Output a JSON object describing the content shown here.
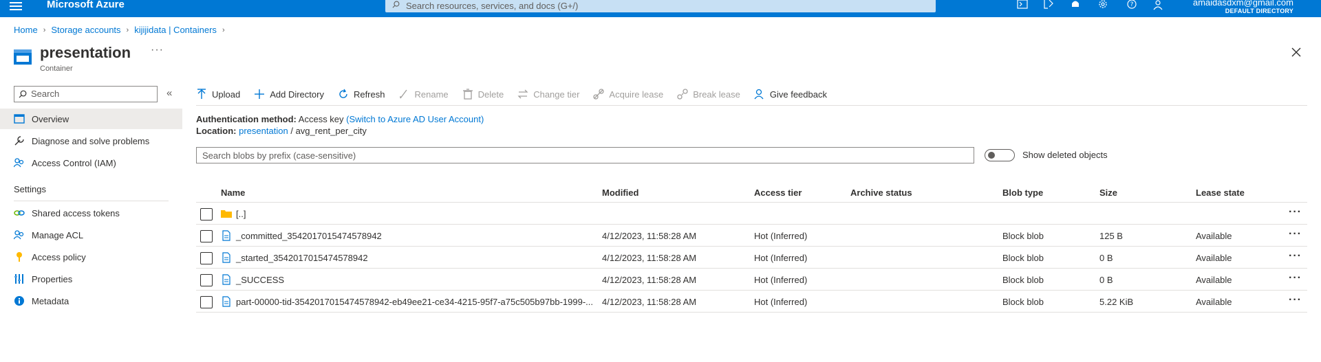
{
  "topbar": {
    "brand": "Microsoft Azure",
    "search_placeholder": "Search resources, services, and docs (G+/)",
    "user_email": "amaidasdxm@gmail.com",
    "directory": "DEFAULT DIRECTORY",
    "icons": [
      "cloud-shell-icon",
      "directory-filter-icon",
      "notifications-icon",
      "settings-icon",
      "help-icon",
      "feedback-icon"
    ]
  },
  "breadcrumb": [
    "Home",
    "Storage accounts",
    "kijijidata | Containers"
  ],
  "page": {
    "title": "presentation",
    "subtitle": "Container",
    "more": "···"
  },
  "sidebar": {
    "search_placeholder": "Search",
    "items": [
      {
        "label": "Overview",
        "icon": "overview-icon"
      },
      {
        "label": "Diagnose and solve problems",
        "icon": "wrench-icon"
      },
      {
        "label": "Access Control (IAM)",
        "icon": "people-icon"
      }
    ],
    "section": "Settings",
    "settings_items": [
      {
        "label": "Shared access tokens",
        "icon": "link-icon"
      },
      {
        "label": "Manage ACL",
        "icon": "people-icon"
      },
      {
        "label": "Access policy",
        "icon": "key-icon"
      },
      {
        "label": "Properties",
        "icon": "properties-icon"
      },
      {
        "label": "Metadata",
        "icon": "info-icon"
      }
    ]
  },
  "toolbar": {
    "upload": "Upload",
    "add_directory": "Add Directory",
    "refresh": "Refresh",
    "rename": "Rename",
    "delete": "Delete",
    "change_tier": "Change tier",
    "acquire_lease": "Acquire lease",
    "break_lease": "Break lease",
    "give_feedback": "Give feedback"
  },
  "info": {
    "auth_label": "Authentication method:",
    "auth_value": "Access key",
    "auth_link": "(Switch to Azure AD User Account)",
    "location_label": "Location:",
    "location_link": "presentation",
    "location_sep": "/",
    "location_path": "avg_rent_per_city"
  },
  "blob_search_placeholder": "Search blobs by prefix (case-sensitive)",
  "show_deleted_label": "Show deleted objects",
  "table": {
    "headers": {
      "name": "Name",
      "modified": "Modified",
      "access_tier": "Access tier",
      "archive_status": "Archive status",
      "blob_type": "Blob type",
      "size": "Size",
      "lease_state": "Lease state"
    },
    "parent_row": "[..]",
    "rows": [
      {
        "name": "_committed_3542017015474578942",
        "modified": "4/12/2023, 11:58:28 AM",
        "access_tier": "Hot (Inferred)",
        "archive_status": "",
        "blob_type": "Block blob",
        "size": "125 B",
        "lease_state": "Available"
      },
      {
        "name": "_started_3542017015474578942",
        "modified": "4/12/2023, 11:58:28 AM",
        "access_tier": "Hot (Inferred)",
        "archive_status": "",
        "blob_type": "Block blob",
        "size": "0 B",
        "lease_state": "Available"
      },
      {
        "name": "_SUCCESS",
        "modified": "4/12/2023, 11:58:28 AM",
        "access_tier": "Hot (Inferred)",
        "archive_status": "",
        "blob_type": "Block blob",
        "size": "0 B",
        "lease_state": "Available"
      },
      {
        "name": "part-00000-tid-3542017015474578942-eb49ee21-ce34-4215-95f7-a75c505b97bb-1999-...",
        "modified": "4/12/2023, 11:58:28 AM",
        "access_tier": "Hot (Inferred)",
        "archive_status": "",
        "blob_type": "Block blob",
        "size": "5.22 KiB",
        "lease_state": "Available"
      }
    ],
    "more_label": "···"
  },
  "colors": {
    "azure_blue": "#0078d4",
    "search_bg": "#c7e0f4",
    "folder": "#ffb900"
  }
}
